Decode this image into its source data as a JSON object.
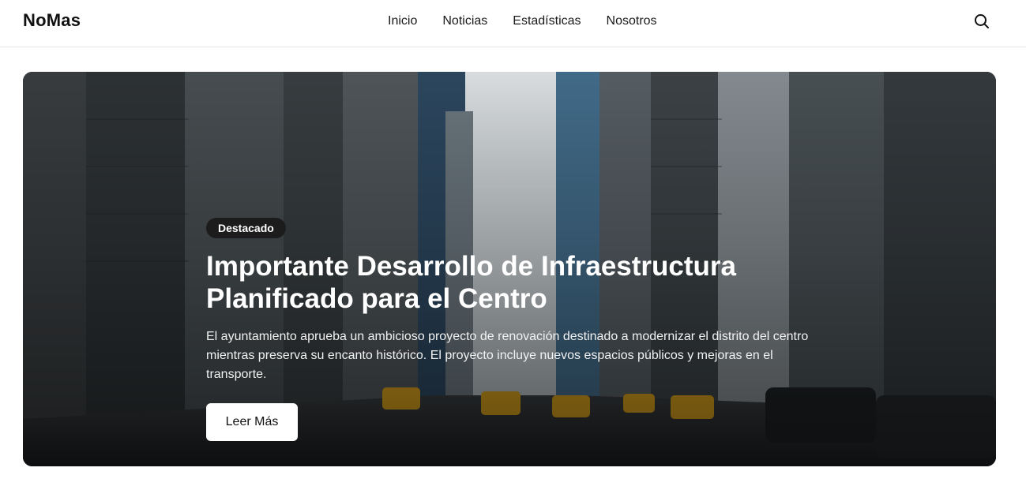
{
  "header": {
    "brand": "NoMas",
    "nav": [
      "Inicio",
      "Noticias",
      "Estadísticas",
      "Nosotros"
    ],
    "search_icon": "search-icon"
  },
  "hero": {
    "badge": "Destacado",
    "title": "Importante Desarrollo de Infraestructura Planificado para el Centro",
    "description": "El ayuntamiento aprueba un ambicioso proyecto de renovación destinado a modernizar el distrito del centro mientras preserva su encanto histórico. El proyecto incluye nuevos espacios públicos y mejoras en el transporte.",
    "cta_label": "Leer Más",
    "image_subject": "city street with skyscrapers and taxis"
  },
  "colors": {
    "badge_bg": "#1c1c1c",
    "hero_text": "#ffffff",
    "cta_bg": "#ffffff"
  }
}
